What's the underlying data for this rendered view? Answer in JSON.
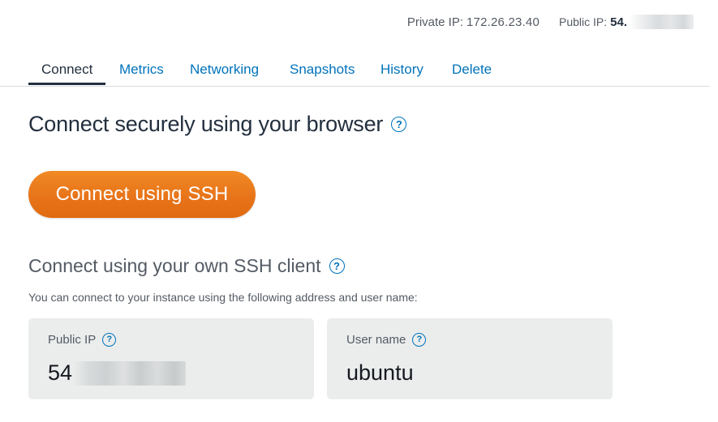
{
  "ipbar": {
    "private_label": "Private IP:",
    "private_value": "172.26.23.40",
    "public_label": "Public IP:",
    "public_value_visible": "54."
  },
  "tabs": [
    {
      "label": "Connect",
      "active": true
    },
    {
      "label": "Metrics",
      "active": false
    },
    {
      "label": "Networking",
      "active": false
    },
    {
      "label": "Snapshots",
      "active": false
    },
    {
      "label": "History",
      "active": false
    },
    {
      "label": "Delete",
      "active": false
    }
  ],
  "browser_section": {
    "heading": "Connect securely using your browser",
    "help_icon": "help-icon",
    "button_label": "Connect using SSH"
  },
  "client_section": {
    "heading": "Connect using your own SSH client",
    "description": "You can connect to your instance using the following address and user name:",
    "public_ip_card": {
      "label": "Public IP",
      "value_visible": "54"
    },
    "user_card": {
      "label": "User name",
      "value": "ubuntu"
    }
  },
  "colors": {
    "accent_link": "#0073bb",
    "button_orange": "#ec7211",
    "card_bg": "#ebeded",
    "text_dark": "#232f3e"
  }
}
